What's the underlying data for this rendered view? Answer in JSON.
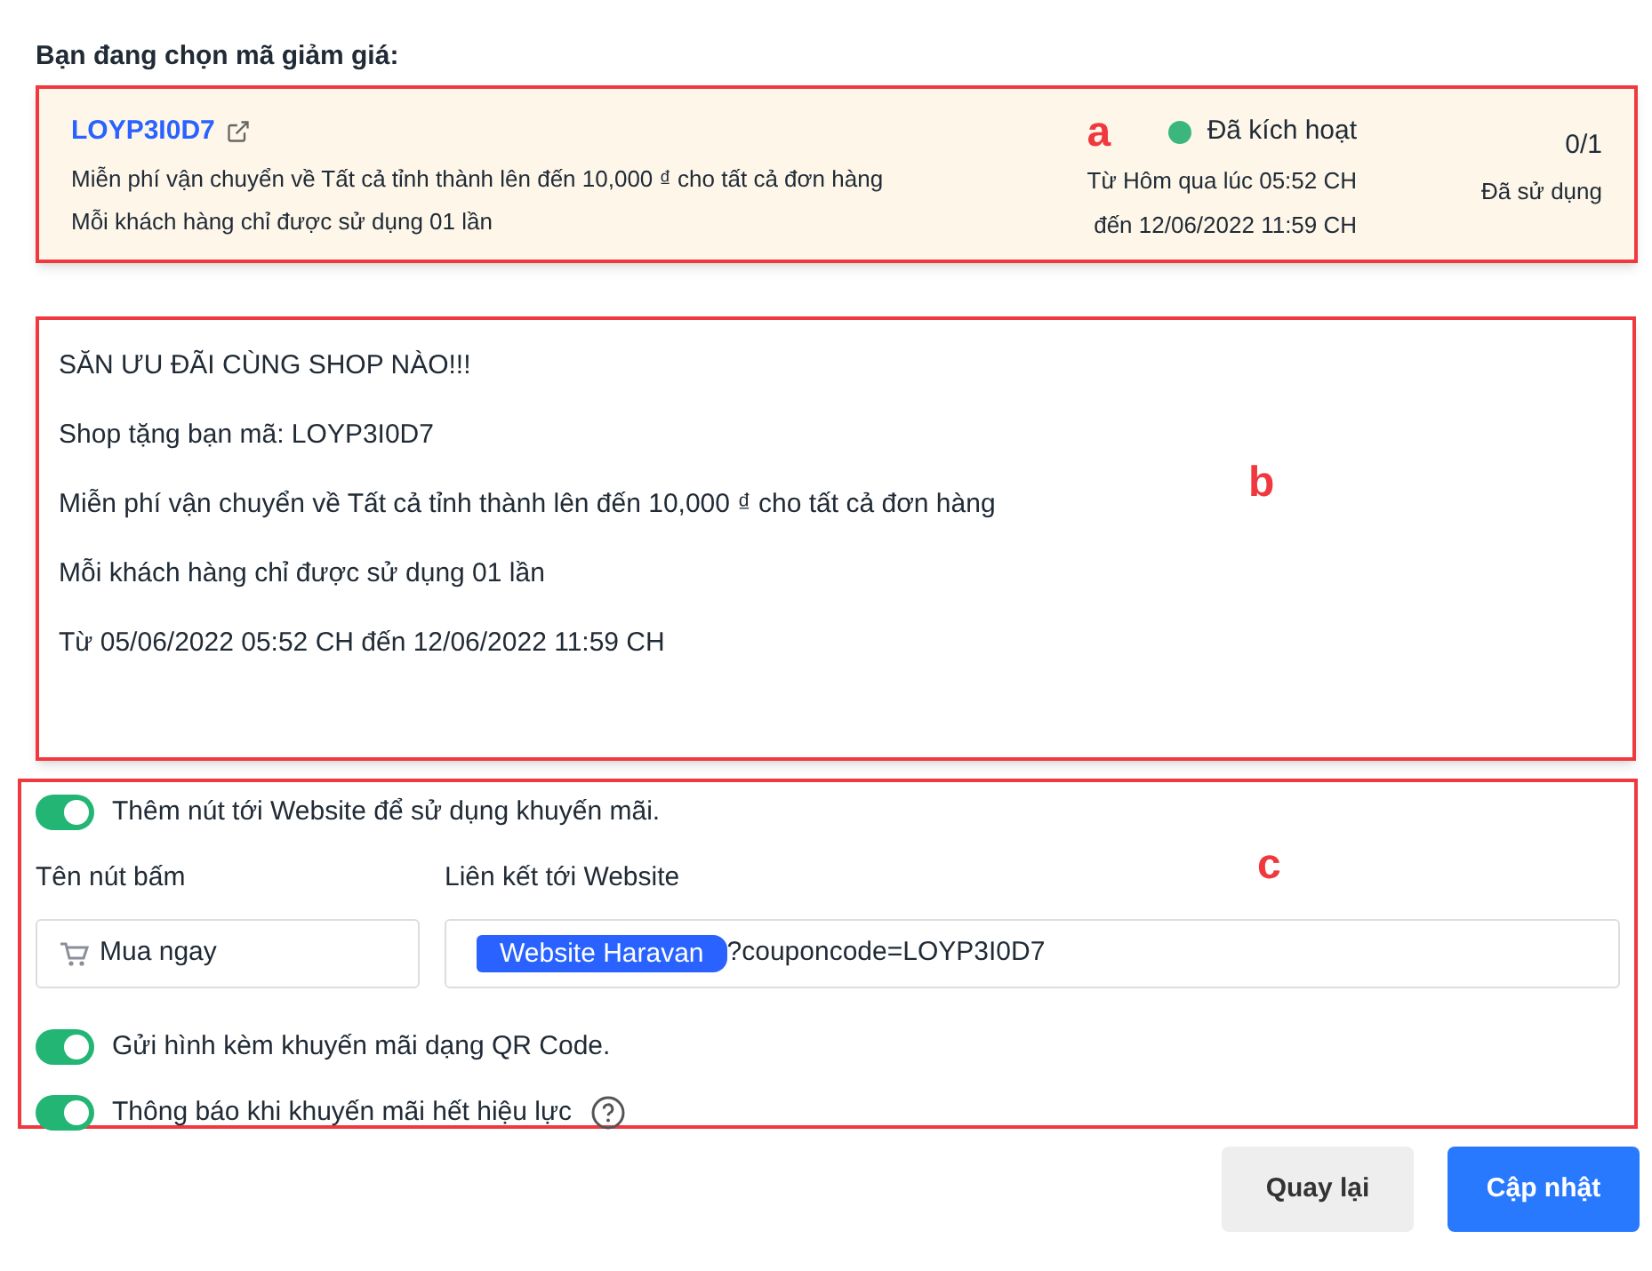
{
  "heading": "Bạn đang chọn mã giảm giá:",
  "coupon": {
    "code": "LOYP3I0D7",
    "lines": [
      "Miễn phí vận chuyển về Tất cả tỉnh thành lên đến 10,000 ₫ cho tất cả đơn hàng",
      "Mỗi khách hàng chỉ được sử dụng 01 lần"
    ],
    "status": "Đã kích hoạt",
    "from": "Từ Hôm qua lúc 05:52 CH",
    "to": "đến 12/06/2022 11:59 CH",
    "usage": "0/1",
    "usage_label": "Đã sử dụng",
    "annotation": "a"
  },
  "message": {
    "lines": [
      "SĂN ƯU ĐÃI CÙNG SHOP NÀO!!!",
      "Shop tặng bạn mã: LOYP3I0D7",
      "Miễn phí vận chuyển về Tất cả tỉnh thành lên đến 10,000 ₫  cho tất cả đơn hàng",
      "Mỗi khách hàng chỉ được sử dụng 01 lần",
      "Từ 05/06/2022 05:52 CH đến 12/06/2022 11:59 CH"
    ],
    "annotation": "b"
  },
  "settings": {
    "annotation": "c",
    "website_toggle": {
      "label": "Thêm nút tới Website để sử dụng khuyến mãi.",
      "on": true
    },
    "button_name": {
      "label": "Tên nút bấm",
      "value": "Mua ngay"
    },
    "link": {
      "label": "Liên kết tới Website",
      "tag": "Website Haravan",
      "value": "?couponcode=LOYP3I0D7"
    },
    "toggles": [
      {
        "label": "Gửi hình kèm khuyến mãi dạng QR Code.",
        "on": true,
        "help": false
      },
      {
        "label": "Thông báo khi khuyến mãi hết hiệu lực",
        "on": true,
        "help": true
      }
    ]
  },
  "buttons": [
    {
      "label": "Quay lại",
      "kind": "secondary"
    },
    {
      "label": "Cập nhật",
      "kind": "primary"
    }
  ]
}
